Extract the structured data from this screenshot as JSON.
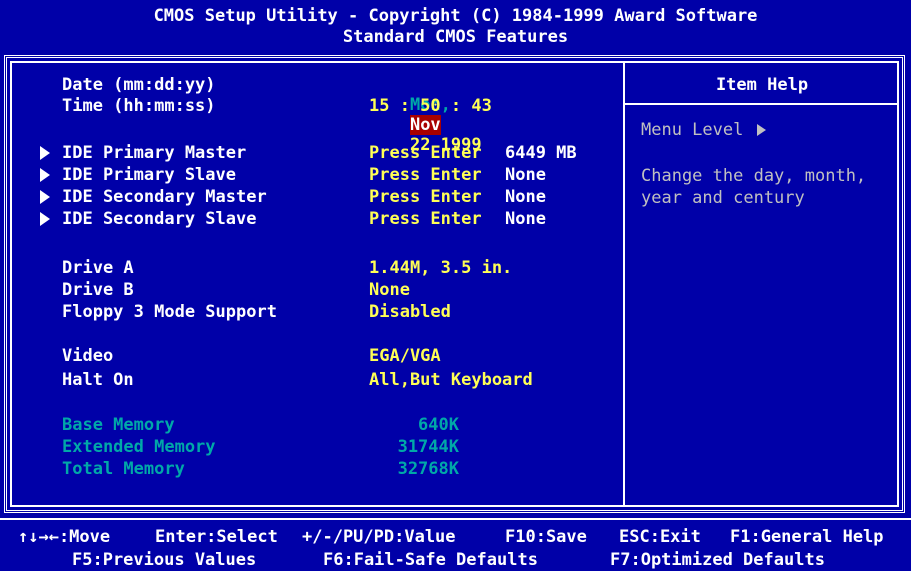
{
  "header": {
    "line1": "CMOS Setup Utility - Copyright (C) 1984-1999 Award Software",
    "line2": "Standard CMOS Features"
  },
  "settings": {
    "date": {
      "label": "Date (mm:dd:yy)",
      "day_name": "Mon,",
      "month": "Nov",
      "rest": "22 1999"
    },
    "time": {
      "label": "Time (hh:mm:ss)",
      "value": "15 : 50 : 43"
    },
    "ide": [
      {
        "label": "IDE Primary Master",
        "action": "Press Enter",
        "value": "6449 MB"
      },
      {
        "label": "IDE Primary Slave",
        "action": "Press Enter",
        "value": "None"
      },
      {
        "label": "IDE Secondary Master",
        "action": "Press Enter",
        "value": "None"
      },
      {
        "label": "IDE Secondary Slave",
        "action": "Press Enter",
        "value": "None"
      }
    ],
    "drive_a": {
      "label": "Drive A",
      "value": "1.44M, 3.5 in."
    },
    "drive_b": {
      "label": "Drive B",
      "value": "None"
    },
    "floppy3": {
      "label": "Floppy 3 Mode Support",
      "value": "Disabled"
    },
    "video": {
      "label": "Video",
      "value": "EGA/VGA"
    },
    "halt_on": {
      "label": "Halt On",
      "value": "All,But Keyboard"
    },
    "memory": [
      {
        "label": "Base Memory",
        "value": "640K"
      },
      {
        "label": "Extended Memory",
        "value": "31744K"
      },
      {
        "label": "Total Memory",
        "value": "32768K"
      }
    ]
  },
  "help": {
    "title": "Item Help",
    "menu_level": "Menu Level",
    "text_line1": "Change the day, month,",
    "text_line2": "year and century"
  },
  "footer": {
    "move": "↑↓→←:Move",
    "enter": "Enter:Select",
    "value": "+/-/PU/PD:Value",
    "save": "F10:Save",
    "exit": "ESC:Exit",
    "help": "F1:General Help",
    "prev": "F5:Previous Values",
    "failsafe": "F6:Fail-Safe Defaults",
    "optimized": "F7:Optimized Defaults"
  },
  "colors": {
    "background": "#0000a8",
    "value_text": "#ffff55",
    "memory_text": "#00a8a8",
    "highlight": "#a80000",
    "help_text": "#c0c0c0"
  }
}
